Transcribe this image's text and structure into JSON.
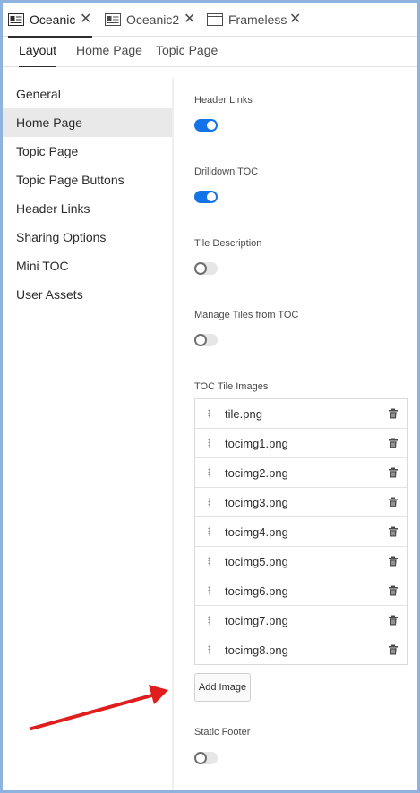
{
  "doc_tabs": [
    {
      "label": "Oceanic",
      "close": "✕"
    },
    {
      "label": "Oceanic2",
      "close": "✕"
    },
    {
      "label": "Frameless",
      "close": "✕"
    }
  ],
  "sub_tabs": [
    "Layout",
    "Home Page",
    "Topic Page"
  ],
  "nav_items": [
    "General",
    "Home Page",
    "Topic Page",
    "Topic Page Buttons",
    "Header Links",
    "Sharing Options",
    "Mini TOC",
    "User Assets"
  ],
  "selected_nav": "Home Page",
  "settings": {
    "header_links": {
      "label": "Header Links",
      "enabled": true
    },
    "drilldown_toc": {
      "label": "Drilldown TOC",
      "enabled": true
    },
    "tile_description": {
      "label": "Tile Description",
      "enabled": false
    },
    "manage_tiles": {
      "label": "Manage Tiles from TOC",
      "enabled": false
    },
    "toc_tile_images_label": "TOC Tile Images",
    "static_footer": {
      "label": "Static Footer",
      "enabled": false
    }
  },
  "toc_images": [
    "tile.png",
    "tocimg1.png",
    "tocimg2.png",
    "tocimg3.png",
    "tocimg4.png",
    "tocimg5.png",
    "tocimg6.png",
    "tocimg7.png",
    "tocimg8.png"
  ],
  "add_image_label": "Add Image",
  "colors": {
    "accent": "#1473e6",
    "annotation_arrow": "#e01e1e",
    "window_border": "#8fb3df"
  },
  "icons": {
    "tab": "document-tab-icon",
    "frame_tab": "window-icon",
    "row_drag": "drag-handle-icon",
    "row_delete": "trash-icon"
  }
}
